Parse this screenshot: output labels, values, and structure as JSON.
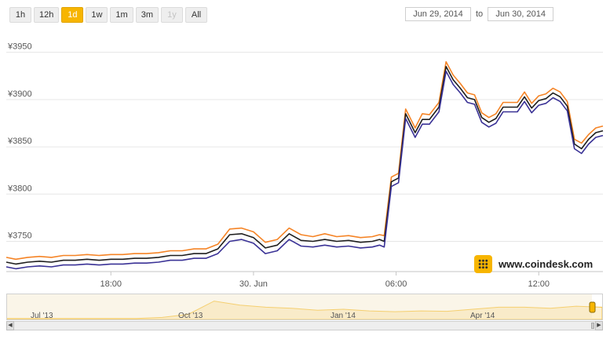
{
  "range_buttons": [
    {
      "label": "1h",
      "state": "normal"
    },
    {
      "label": "12h",
      "state": "normal"
    },
    {
      "label": "1d",
      "state": "active"
    },
    {
      "label": "1w",
      "state": "normal"
    },
    {
      "label": "1m",
      "state": "normal"
    },
    {
      "label": "3m",
      "state": "normal"
    },
    {
      "label": "1y",
      "state": "disabled"
    },
    {
      "label": "All",
      "state": "normal"
    }
  ],
  "date_range": {
    "from": "Jun 29, 2014",
    "to_label": "to",
    "to": "Jun 30, 2014"
  },
  "logo": {
    "text": "www.coindesk.com"
  },
  "colors": {
    "high": "#f58426",
    "close": "#1e1e1e",
    "low": "#3a3296",
    "grid": "#e6e6e6",
    "navigator": "#f7c547",
    "accent": "#f7b500"
  },
  "chart_data": {
    "type": "line",
    "title": "",
    "ylabel": "",
    "y_ticks": [
      "¥3750",
      "¥3800",
      "¥3850",
      "¥3900",
      "¥3950"
    ],
    "y_tick_values": [
      3750,
      3800,
      3850,
      3900,
      3950
    ],
    "ylim": [
      3718,
      3968
    ],
    "x_ticks": [
      "18:00",
      "30. Jun",
      "06:00",
      "12:00"
    ],
    "x_tick_hours": [
      18,
      24,
      30,
      36
    ],
    "xlim": [
      13.6,
      38.7
    ],
    "grid": true,
    "x_hours": [
      13.6,
      14.0,
      14.5,
      15.0,
      15.5,
      16.0,
      16.5,
      17.0,
      17.5,
      18.0,
      18.5,
      19.0,
      19.5,
      20.0,
      20.5,
      21.0,
      21.5,
      22.0,
      22.5,
      23.0,
      23.5,
      24.0,
      24.5,
      25.0,
      25.5,
      26.0,
      26.5,
      27.0,
      27.5,
      28.0,
      28.5,
      29.0,
      29.3,
      29.5,
      29.8,
      30.1,
      30.4,
      30.8,
      31.1,
      31.4,
      31.8,
      32.1,
      32.4,
      32.7,
      33.0,
      33.3,
      33.6,
      33.9,
      34.2,
      34.5,
      34.8,
      35.1,
      35.4,
      35.7,
      36.0,
      36.3,
      36.6,
      36.9,
      37.2,
      37.5,
      37.8,
      38.1,
      38.4,
      38.7
    ],
    "series": [
      {
        "values": [
          3733,
          3731,
          3733,
          3734,
          3733,
          3735,
          3735,
          3736,
          3735,
          3736,
          3736,
          3737,
          3737,
          3738,
          3740,
          3740,
          3742,
          3742,
          3747,
          3763,
          3764,
          3760,
          3749,
          3752,
          3764,
          3757,
          3755,
          3758,
          3755,
          3756,
          3754,
          3755,
          3757,
          3756,
          3818,
          3822,
          3890,
          3870,
          3885,
          3884,
          3897,
          3940,
          3926,
          3917,
          3907,
          3905,
          3886,
          3881,
          3885,
          3897,
          3897,
          3897,
          3908,
          3896,
          3904,
          3906,
          3912,
          3908,
          3898,
          3858,
          3854,
          3863,
          3870,
          3872
        ]
      },
      {
        "values": [
          3728,
          3726,
          3728,
          3729,
          3728,
          3730,
          3730,
          3731,
          3730,
          3731,
          3731,
          3732,
          3732,
          3733,
          3735,
          3735,
          3737,
          3737,
          3742,
          3757,
          3758,
          3754,
          3743,
          3746,
          3758,
          3751,
          3750,
          3752,
          3750,
          3751,
          3749,
          3750,
          3752,
          3750,
          3813,
          3817,
          3885,
          3865,
          3879,
          3879,
          3892,
          3935,
          3921,
          3912,
          3902,
          3900,
          3881,
          3876,
          3880,
          3892,
          3892,
          3892,
          3903,
          3891,
          3899,
          3901,
          3907,
          3903,
          3893,
          3853,
          3848,
          3858,
          3865,
          3867
        ]
      },
      {
        "values": [
          3723,
          3721,
          3723,
          3724,
          3723,
          3725,
          3725,
          3726,
          3725,
          3726,
          3726,
          3727,
          3727,
          3728,
          3730,
          3730,
          3732,
          3732,
          3737,
          3750,
          3752,
          3748,
          3737,
          3740,
          3752,
          3745,
          3744,
          3746,
          3744,
          3745,
          3743,
          3744,
          3746,
          3744,
          3808,
          3812,
          3880,
          3860,
          3874,
          3874,
          3887,
          3930,
          3916,
          3907,
          3897,
          3895,
          3876,
          3871,
          3875,
          3887,
          3887,
          3887,
          3898,
          3886,
          3894,
          3896,
          3902,
          3898,
          3888,
          3848,
          3843,
          3853,
          3860,
          3862
        ]
      }
    ]
  },
  "navigator": {
    "labels": [
      "Jul '13",
      "Oct '13",
      "Jan '14",
      "Apr '14"
    ],
    "values": [
      0.05,
      0.05,
      0.05,
      0.05,
      0.05,
      0.05,
      0.1,
      0.25,
      0.9,
      0.7,
      0.6,
      0.55,
      0.45,
      0.5,
      0.42,
      0.38,
      0.42,
      0.4,
      0.5,
      0.6,
      0.6,
      0.55,
      0.65,
      0.6
    ]
  }
}
